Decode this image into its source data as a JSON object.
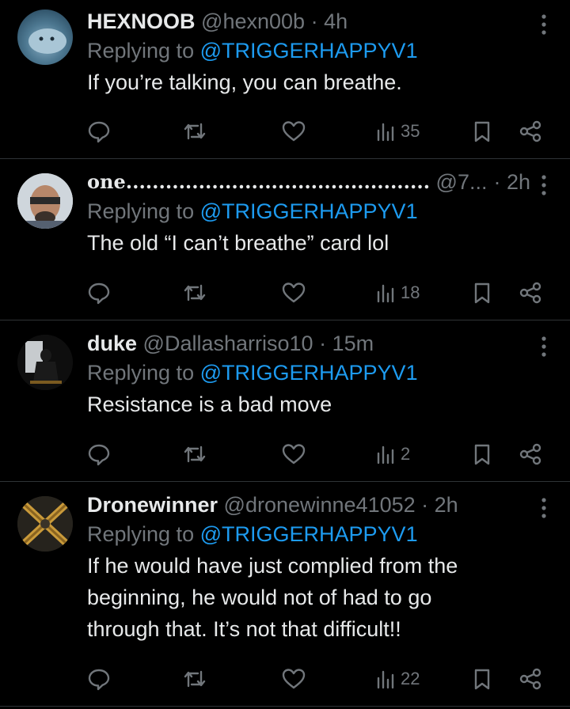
{
  "tweets": [
    {
      "display_name": "HEXNOOB",
      "handle": "@hexn00b",
      "time": "· 4h",
      "reply_label": "Replying to",
      "mention": "@TRIGGERHAPPYV1",
      "text": "If you’re talking, you can breathe.",
      "views": "35"
    },
    {
      "display_name": "one........................................................",
      "handle": "@7...",
      "time": "· 2h",
      "reply_label": "Replying to",
      "mention": "@TRIGGERHAPPYV1",
      "text": "The old “I can’t breathe” card lol",
      "views": "18"
    },
    {
      "display_name": "duke",
      "handle": "@Dallasharriso10",
      "time": "· 15m",
      "reply_label": "Replying to",
      "mention": "@TRIGGERHAPPYV1",
      "text": "Resistance is a bad move",
      "views": "2"
    },
    {
      "display_name": "Dronewinner",
      "handle": "@dronewinne41052",
      "time": "· 2h",
      "reply_label": "Replying to",
      "mention": "@TRIGGERHAPPYV1",
      "text": "If he would have just complied from the\nbeginning, he would not of had to go\nthrough that. It’s not that difficult!!",
      "views": "22"
    }
  ],
  "icons": {
    "reply": "reply-icon",
    "retweet": "retweet-icon",
    "like": "like-icon",
    "views": "views-icon",
    "bookmark": "bookmark-icon",
    "share": "share-icon",
    "more": "more-icon"
  },
  "colors": {
    "background": "#000000",
    "text": "#e7e9ea",
    "secondary": "#71767b",
    "mention": "#1d9bf0",
    "divider": "#2f3336"
  }
}
